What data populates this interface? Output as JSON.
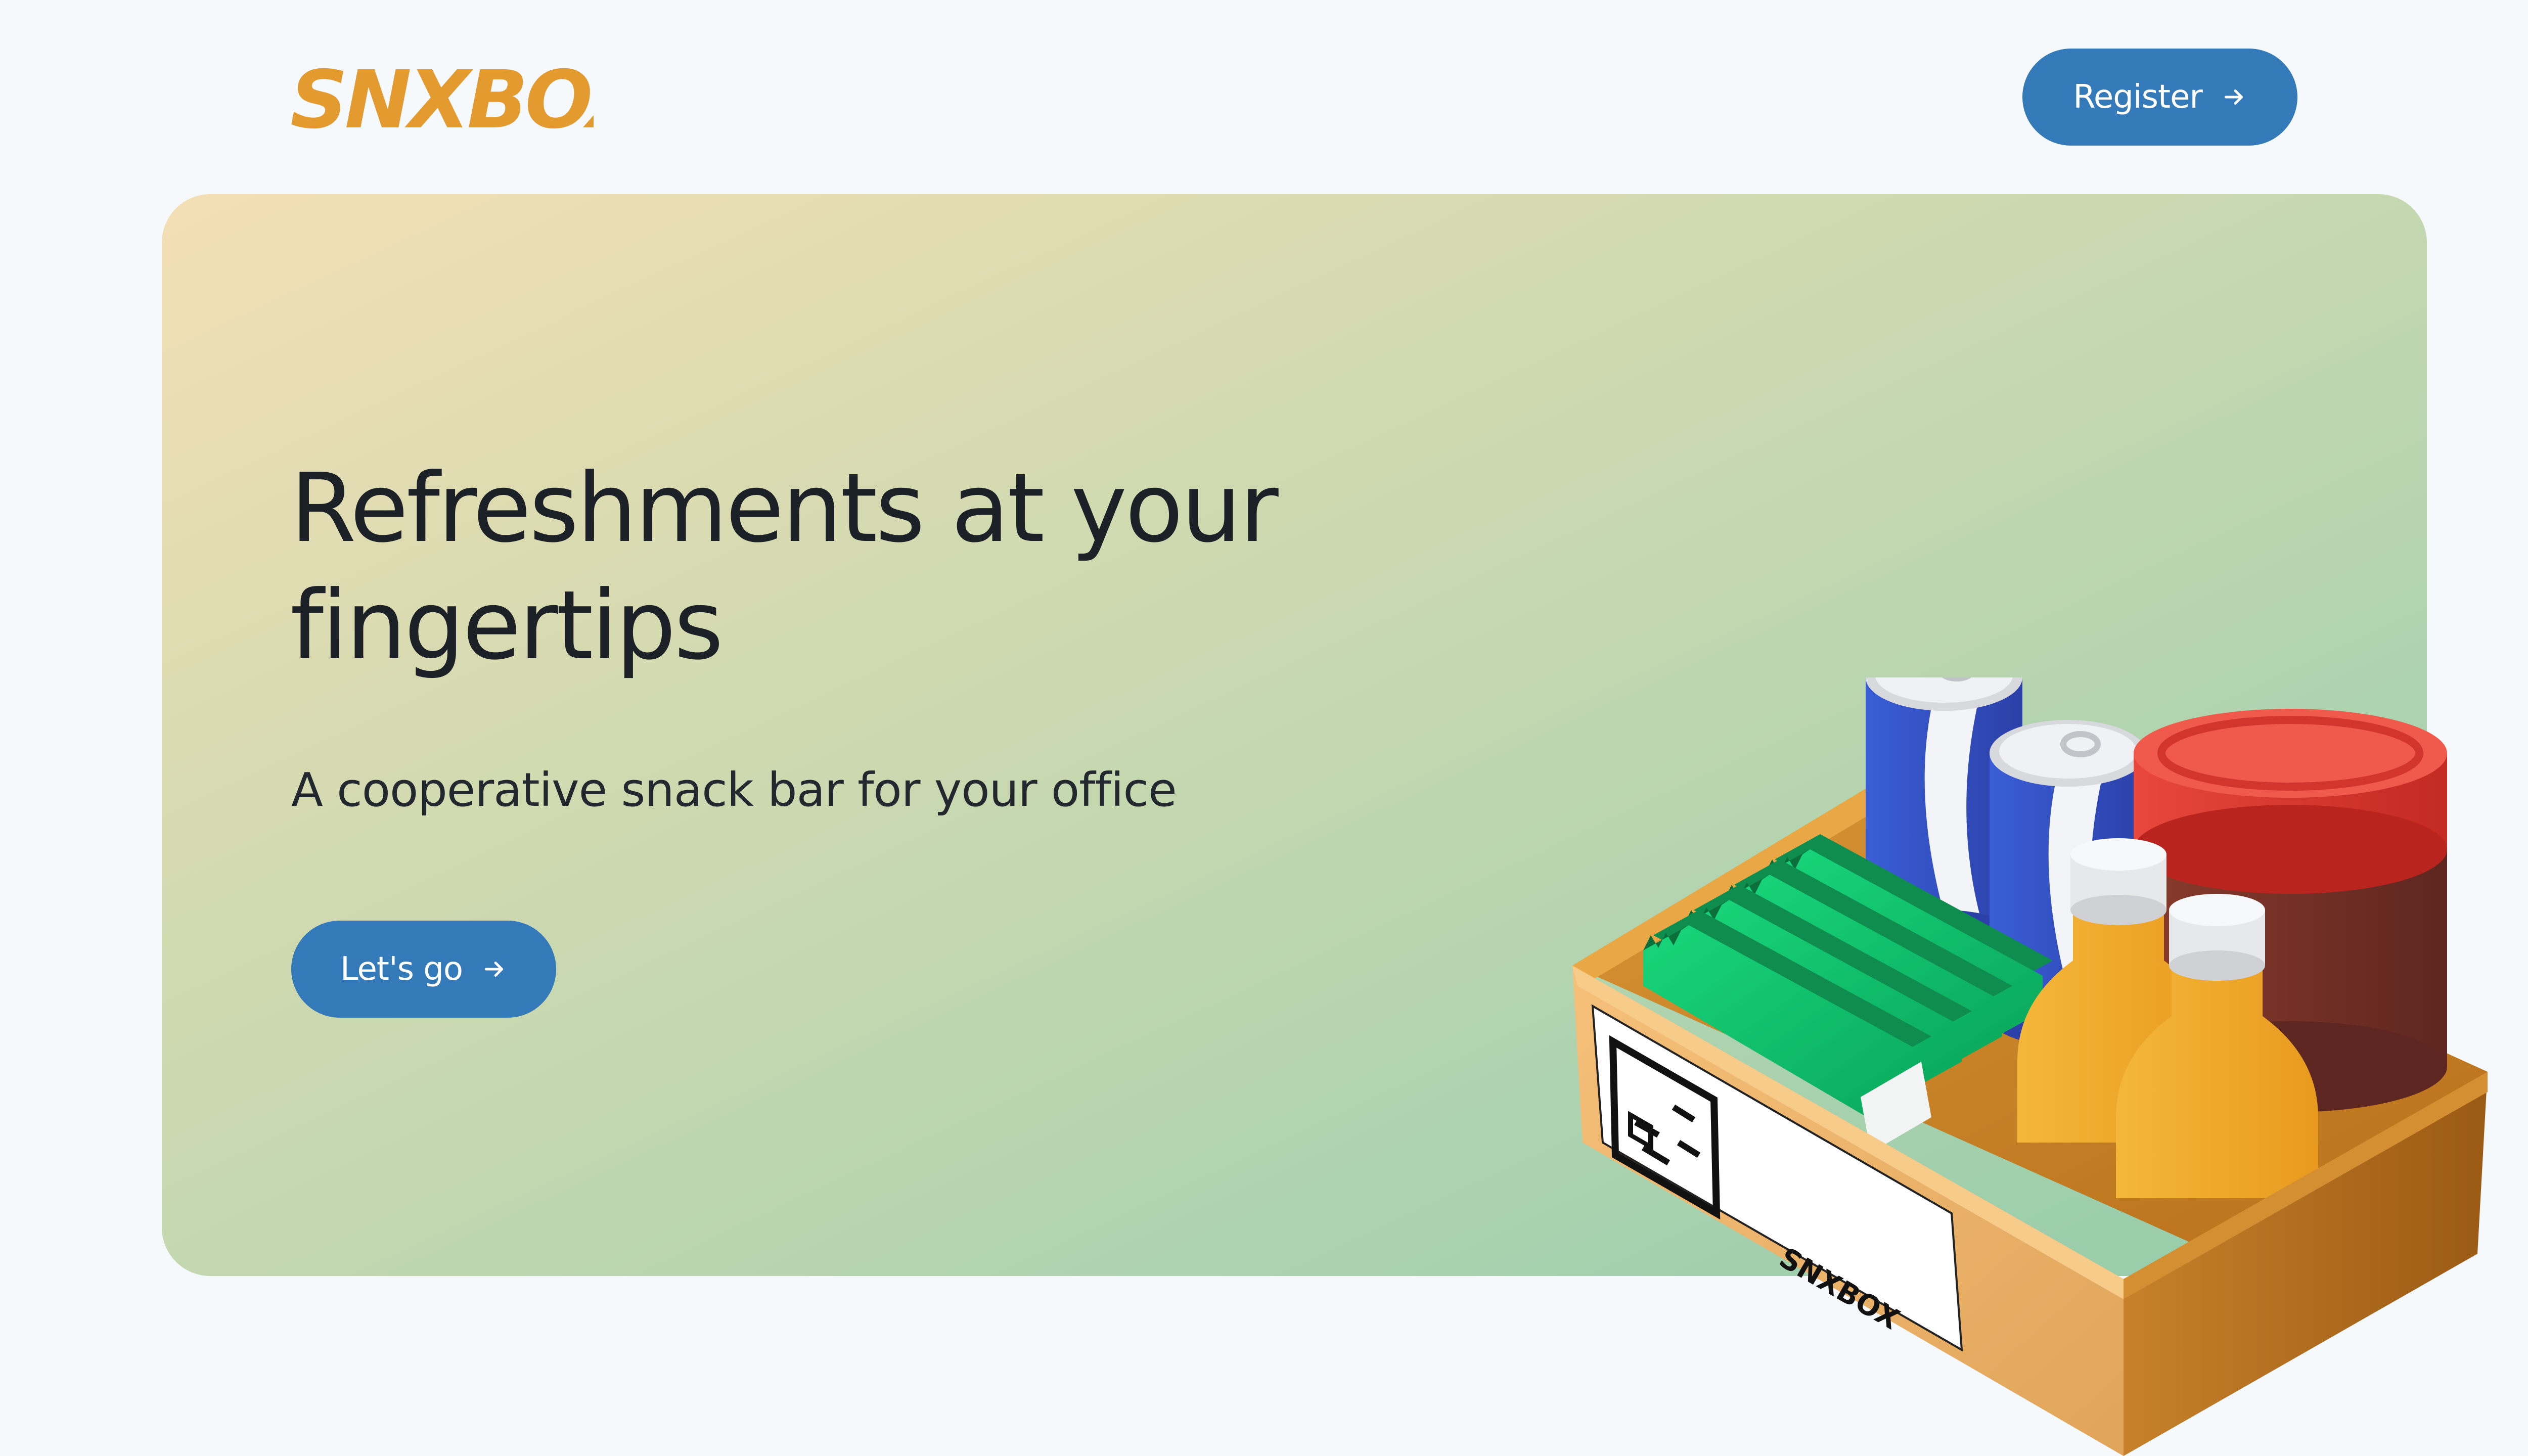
{
  "header": {
    "logo_text": "SNXBOX",
    "register_label": "Register"
  },
  "hero": {
    "headline": "Refreshments at your fingertips",
    "subheadline": "A cooperative snack bar for your office",
    "cta_label": "Let's go"
  },
  "illustration": {
    "box_label": "SNXBOX"
  },
  "colors": {
    "brand_orange": "#e39a2f",
    "button_blue": "#3479b8",
    "background": "#f5f9fb",
    "hero_gradient_start": "#f4dfb5",
    "hero_gradient_end": "#94cca9",
    "text_dark": "#1c2128"
  },
  "icons": {
    "register_button_icon": "arrow-right-icon",
    "cta_button_icon": "arrow-right-icon"
  }
}
